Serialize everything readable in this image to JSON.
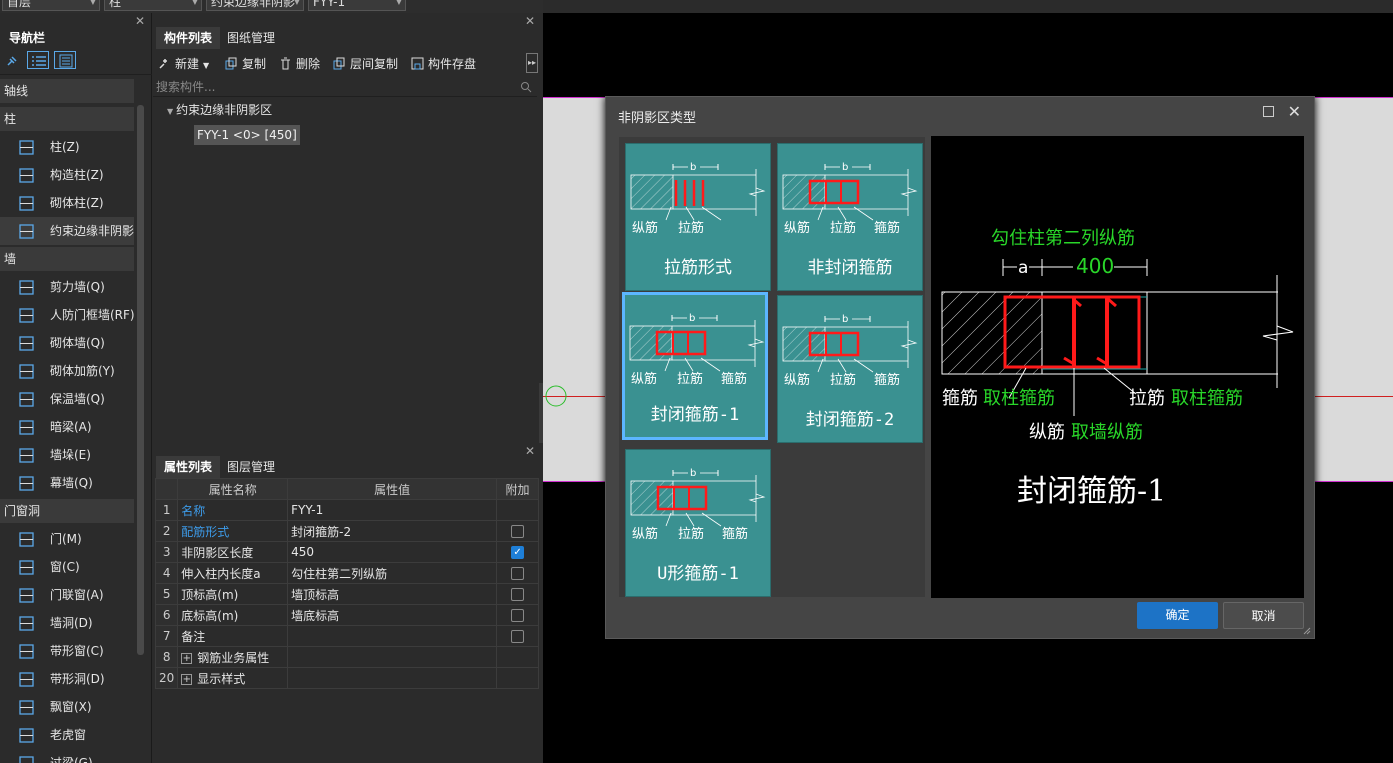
{
  "topbar": {
    "sel1": "首层",
    "sel2": "柱",
    "sel3": "约束边缘非阴影",
    "sel4": "FYY-1"
  },
  "nav": {
    "title": "导航栏",
    "categories": {
      "axis": "轴线",
      "column": "柱",
      "wall": "墙",
      "door": "门窗洞"
    },
    "items": [
      {
        "label": "柱(Z)",
        "name": "column"
      },
      {
        "label": "构造柱(Z)",
        "name": "construct-column"
      },
      {
        "label": "砌体柱(Z)",
        "name": "masonry-column"
      },
      {
        "label": "约束边缘非阴影",
        "name": "constraint-edge"
      },
      {
        "label": "剪力墙(Q)",
        "name": "shear-wall"
      },
      {
        "label": "人防门框墙(RF)",
        "name": "civil-defense-wall"
      },
      {
        "label": "砌体墙(Q)",
        "name": "masonry-wall"
      },
      {
        "label": "砌体加筋(Y)",
        "name": "masonry-rebar"
      },
      {
        "label": "保温墙(Q)",
        "name": "insulation-wall"
      },
      {
        "label": "暗梁(A)",
        "name": "hidden-beam"
      },
      {
        "label": "墙垛(E)",
        "name": "wall-pier"
      },
      {
        "label": "幕墙(Q)",
        "name": "curtain-wall"
      },
      {
        "label": "门(M)",
        "name": "door"
      },
      {
        "label": "窗(C)",
        "name": "window"
      },
      {
        "label": "门联窗(A)",
        "name": "door-window"
      },
      {
        "label": "墙洞(D)",
        "name": "wall-hole"
      },
      {
        "label": "带形窗(C)",
        "name": "strip-window"
      },
      {
        "label": "带形洞(D)",
        "name": "strip-hole"
      },
      {
        "label": "飘窗(X)",
        "name": "bay-window"
      },
      {
        "label": "老虎窗",
        "name": "dormer"
      },
      {
        "label": "过梁(G)",
        "name": "lintel"
      }
    ]
  },
  "comp": {
    "tabs": [
      "构件列表",
      "图纸管理"
    ],
    "toolbar": {
      "new": "新建",
      "copy": "复制",
      "delete": "删除",
      "floor_copy": "层间复制",
      "save": "构件存盘"
    },
    "search_placeholder": "搜索构件...",
    "tree_parent": "约束边缘非阴影区",
    "tree_child": "FYY-1 <0> [450]"
  },
  "props": {
    "tabs": [
      "属性列表",
      "图层管理"
    ],
    "headers": [
      "属性名称",
      "属性值",
      "附加"
    ],
    "rows": [
      {
        "num": "1",
        "name": "名称",
        "value": "FYY-1"
      },
      {
        "num": "2",
        "name": "配筋形式",
        "value": "封闭箍筋-2"
      },
      {
        "num": "3",
        "name": "非阴影区长度",
        "value": "450"
      },
      {
        "num": "4",
        "name": "伸入柱内长度a",
        "value": "勾住柱第二列纵筋"
      },
      {
        "num": "5",
        "name": "顶标高(m)",
        "value": "墙顶标高"
      },
      {
        "num": "6",
        "name": "底标高(m)",
        "value": "墙底标高"
      },
      {
        "num": "7",
        "name": "备注",
        "value": ""
      },
      {
        "num": "8",
        "name": "钢筋业务属性",
        "value": ""
      },
      {
        "num": "20",
        "name": "显示样式",
        "value": ""
      }
    ],
    "checkbox_state": [
      false,
      true,
      false,
      false,
      false,
      false
    ]
  },
  "dialog": {
    "title": "非阴影区类型",
    "options": [
      "拉筋形式",
      "非封闭箍筋",
      "封闭箍筋-1",
      "封闭箍筋-2",
      "U形箍筋-1"
    ],
    "selected": "封闭箍筋-1",
    "ok": "确定",
    "cancel": "取消",
    "thumb_text": {
      "a": "a",
      "b": "b",
      "zong": "纵筋",
      "la": "拉筋",
      "gu": "箍筋"
    },
    "preview": {
      "top_label": "勾住柱第二列纵筋",
      "dim_a": "a",
      "dim_400": "400",
      "gujin": "箍筋",
      "gujin_take": "取柱箍筋",
      "lajin": "拉筋",
      "lajin_take": "取柱箍筋",
      "zongjin": "纵筋",
      "zongjin_take": "取墙纵筋",
      "name": "封闭箍筋-1"
    }
  },
  "colors": {
    "accent": "#1d73c6",
    "teal": "#3a9191",
    "red": "#ff1a1a",
    "green": "#29d629",
    "link": "#3d9be9"
  }
}
